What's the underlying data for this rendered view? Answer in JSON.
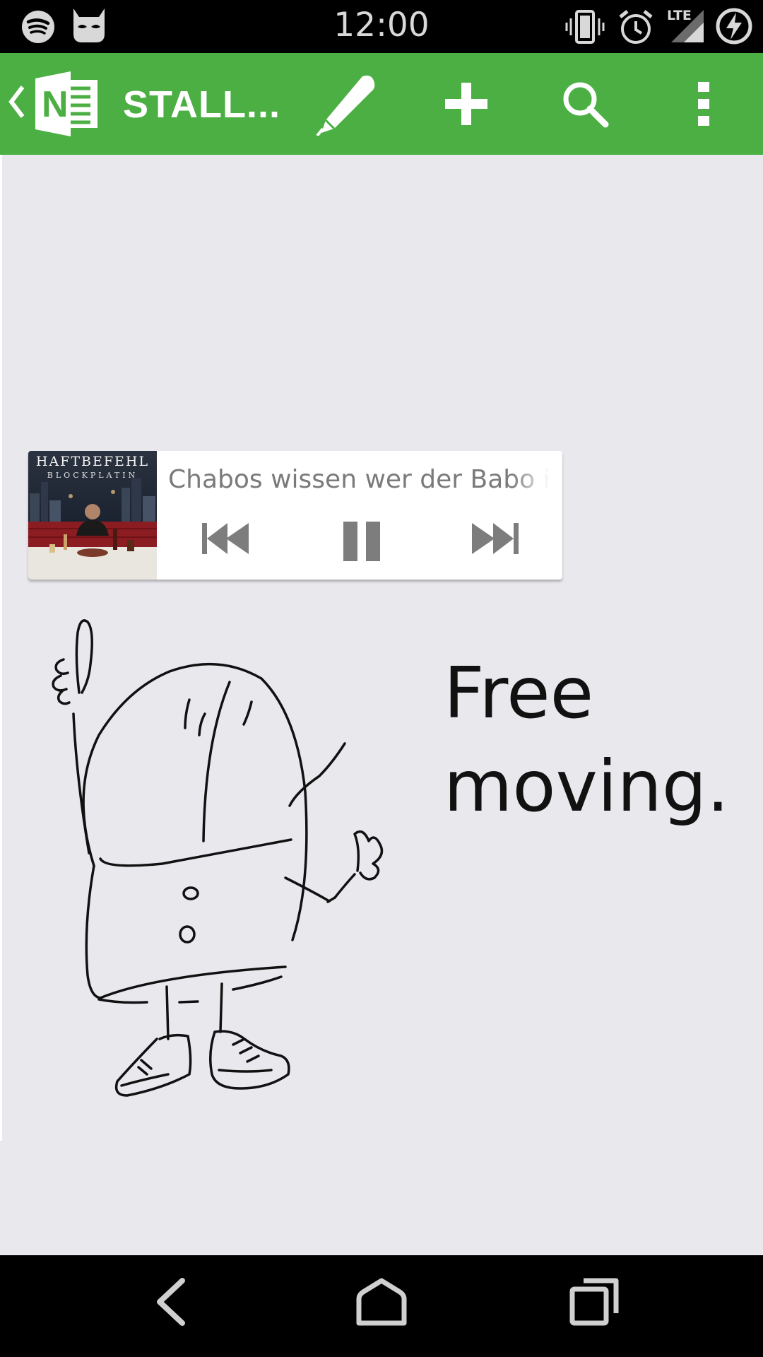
{
  "status_bar": {
    "time": "12:00",
    "network_label": "LTE",
    "icons": [
      "spotify-icon",
      "cyanogenmod-icon",
      "vibrate-icon",
      "alarm-icon",
      "lte-signal-icon",
      "battery-charging-icon"
    ]
  },
  "action_bar": {
    "title": "STALL...",
    "background_color": "#4caf43",
    "icons": [
      "back-chevron-icon",
      "onenote-logo-icon",
      "pen-icon",
      "plus-icon",
      "search-icon",
      "overflow-menu-icon"
    ]
  },
  "media_widget": {
    "album_art_title": "HAFTBEFEHL",
    "album_art_subtitle": "BLOCKPLATIN",
    "track_title": "Chabos wissen wer der Babo ist",
    "controls": [
      "previous-icon",
      "pause-icon",
      "next-icon"
    ]
  },
  "canvas": {
    "handwritten_text": "Free\nmoving.",
    "background_color": "#e9e8ed"
  },
  "nav_bar": {
    "icons": [
      "nav-back-icon",
      "nav-home-icon",
      "nav-recents-icon"
    ]
  }
}
